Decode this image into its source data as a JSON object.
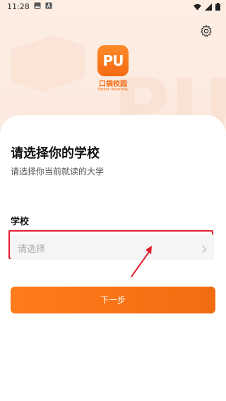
{
  "status_bar": {
    "time": "11:28",
    "left_icons": [
      "image-icon",
      "a-badge-icon"
    ],
    "right_icons": [
      "wifi-icon",
      "signal-icon",
      "battery-icon"
    ]
  },
  "header": {
    "settings_icon": "gear-icon",
    "logo": {
      "mark": "PU",
      "name_cn": "口袋校园",
      "name_en": "Pocket University"
    }
  },
  "card": {
    "title": "请选择你的学校",
    "subtitle": "请选择你当前就读的大学",
    "school_field": {
      "label": "学校",
      "placeholder": "请选择"
    },
    "next_button": "下一步"
  },
  "colors": {
    "accent": "#f36c10",
    "highlight": "#e11d2e"
  }
}
